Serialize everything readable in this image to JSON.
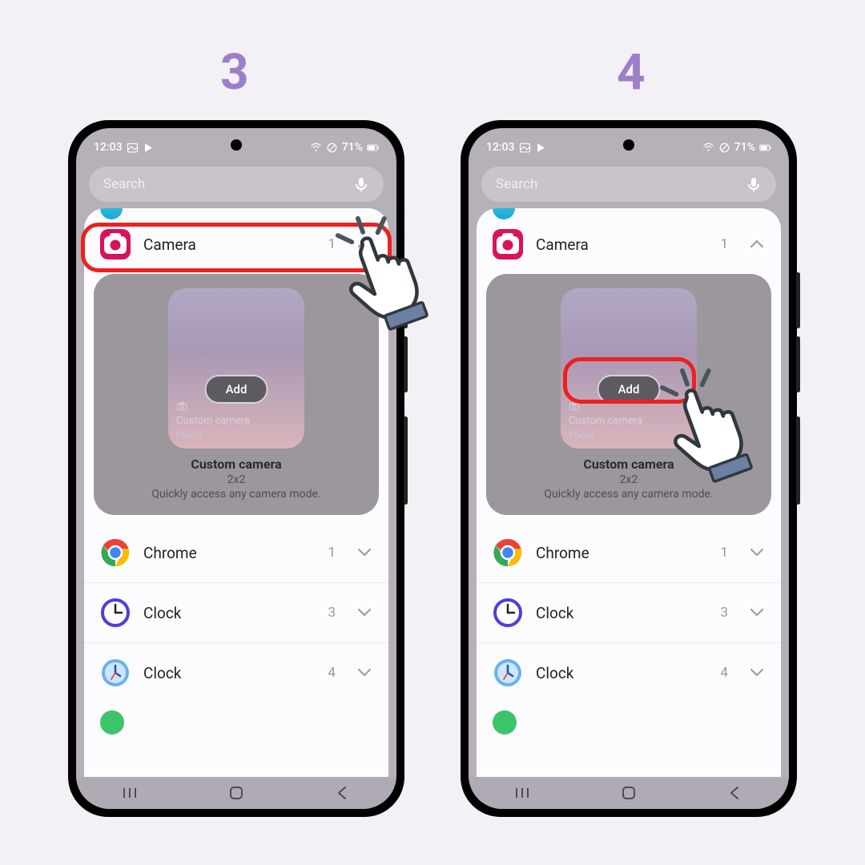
{
  "steps": {
    "left": "3",
    "right": "4"
  },
  "statusbar": {
    "time": "12:03",
    "battery": "71%"
  },
  "search": {
    "placeholder": "Search"
  },
  "camera_row": {
    "label": "Camera",
    "count": "1"
  },
  "widget": {
    "add": "Add",
    "preview_line1": "Custom camera",
    "preview_line2": "Photo",
    "title": "Custom camera",
    "size": "2x2",
    "desc": "Quickly access any camera mode."
  },
  "rows": [
    {
      "label": "Chrome",
      "count": "1"
    },
    {
      "label": "Clock",
      "count": "3"
    },
    {
      "label": "Clock",
      "count": "4"
    }
  ],
  "colors": {
    "accent": "#9b7fc9",
    "highlight": "#ef1f1f",
    "camera": "#d8125b"
  }
}
